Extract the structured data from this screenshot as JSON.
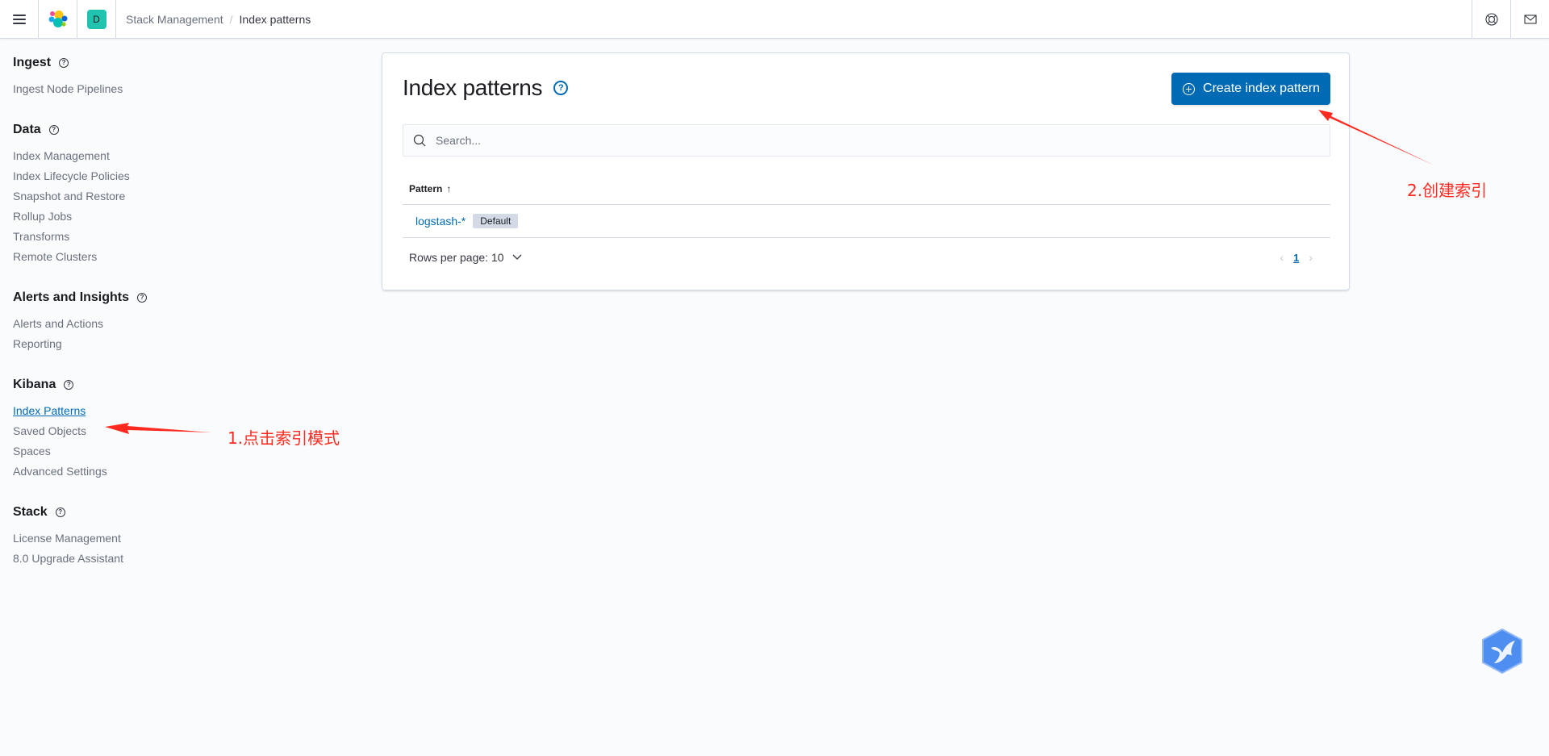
{
  "header": {
    "menu_icon": "hamburger-icon",
    "logo_icon": "elastic-logo-icon",
    "space_avatar": "D",
    "breadcrumbs": [
      {
        "label": "Stack Management"
      },
      {
        "label": "Index patterns"
      }
    ],
    "separator": "/",
    "right_icons": [
      "help-lifebuoy-icon",
      "mail-icon"
    ]
  },
  "sidebar": {
    "groups": [
      {
        "title": "Ingest",
        "items": [
          {
            "label": "Ingest Node Pipelines"
          }
        ]
      },
      {
        "title": "Data",
        "items": [
          {
            "label": "Index Management"
          },
          {
            "label": "Index Lifecycle Policies"
          },
          {
            "label": "Snapshot and Restore"
          },
          {
            "label": "Rollup Jobs"
          },
          {
            "label": "Transforms"
          },
          {
            "label": "Remote Clusters"
          }
        ]
      },
      {
        "title": "Alerts and Insights",
        "items": [
          {
            "label": "Alerts and Actions"
          },
          {
            "label": "Reporting"
          }
        ]
      },
      {
        "title": "Kibana",
        "items": [
          {
            "label": "Index Patterns",
            "active": true
          },
          {
            "label": "Saved Objects"
          },
          {
            "label": "Spaces"
          },
          {
            "label": "Advanced Settings"
          }
        ]
      },
      {
        "title": "Stack",
        "items": [
          {
            "label": "License Management"
          },
          {
            "label": "8.0 Upgrade Assistant"
          }
        ]
      }
    ],
    "help_glyph": "?"
  },
  "main": {
    "title": "Index patterns",
    "help_glyph": "?",
    "create_button": "Create index pattern",
    "search_placeholder": "Search...",
    "table": {
      "column_header": "Pattern",
      "sort_indicator": "↑",
      "rows": [
        {
          "pattern": "logstash-*",
          "badge": "Default"
        }
      ]
    },
    "rows_per_page": "Rows per page: 10",
    "pagination": {
      "prev": "‹",
      "current": "1",
      "next": "›"
    }
  },
  "annotations": {
    "step1": "1.点击索引模式",
    "step2": "2.创建索引",
    "color": "#ff2a1f"
  },
  "colors": {
    "primary": "#006bb4",
    "space_avatar": "#20c3b0",
    "text": "#343741",
    "subdued": "#69707d"
  }
}
